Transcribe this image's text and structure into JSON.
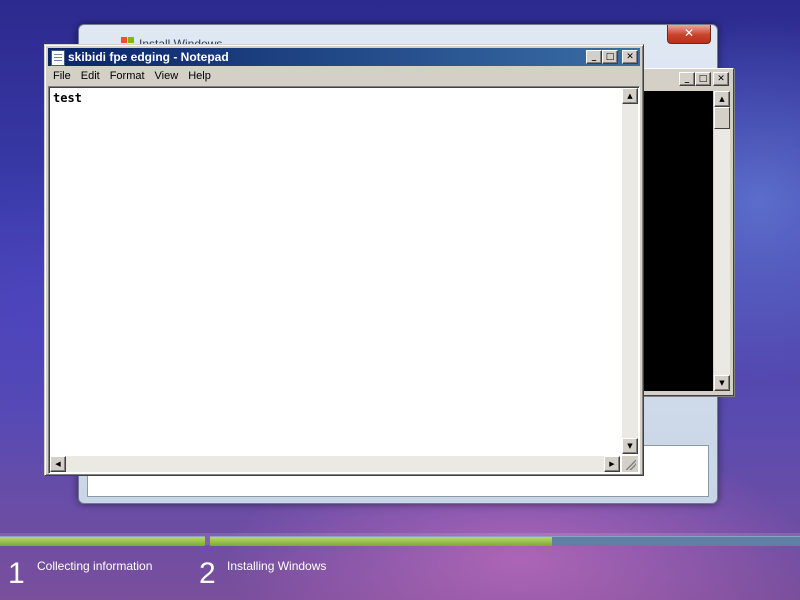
{
  "install_window": {
    "title": "Install Windows",
    "close_label": "✕"
  },
  "notepad": {
    "title": "skibidi fpe edging - Notepad",
    "menu": [
      "File",
      "Edit",
      "Format",
      "View",
      "Help"
    ],
    "text": "test",
    "caption_buttons": {
      "minimize": "_",
      "maximize": "□",
      "close": "✕"
    }
  },
  "console": {
    "caption_buttons": {
      "minimize": "_",
      "maximize": "□",
      "close": "✕"
    }
  },
  "setup": {
    "stages": [
      {
        "number": "1",
        "label": "Collecting information",
        "progress": 1.0
      },
      {
        "number": "2",
        "label": "Installing Windows",
        "progress": 0.58
      }
    ]
  },
  "colors": {
    "titlebar_start": "#0a246a",
    "titlebar_end": "#3a6ea5",
    "progress_green": "#8cc63f",
    "progress_track": "#5f7fa5"
  }
}
